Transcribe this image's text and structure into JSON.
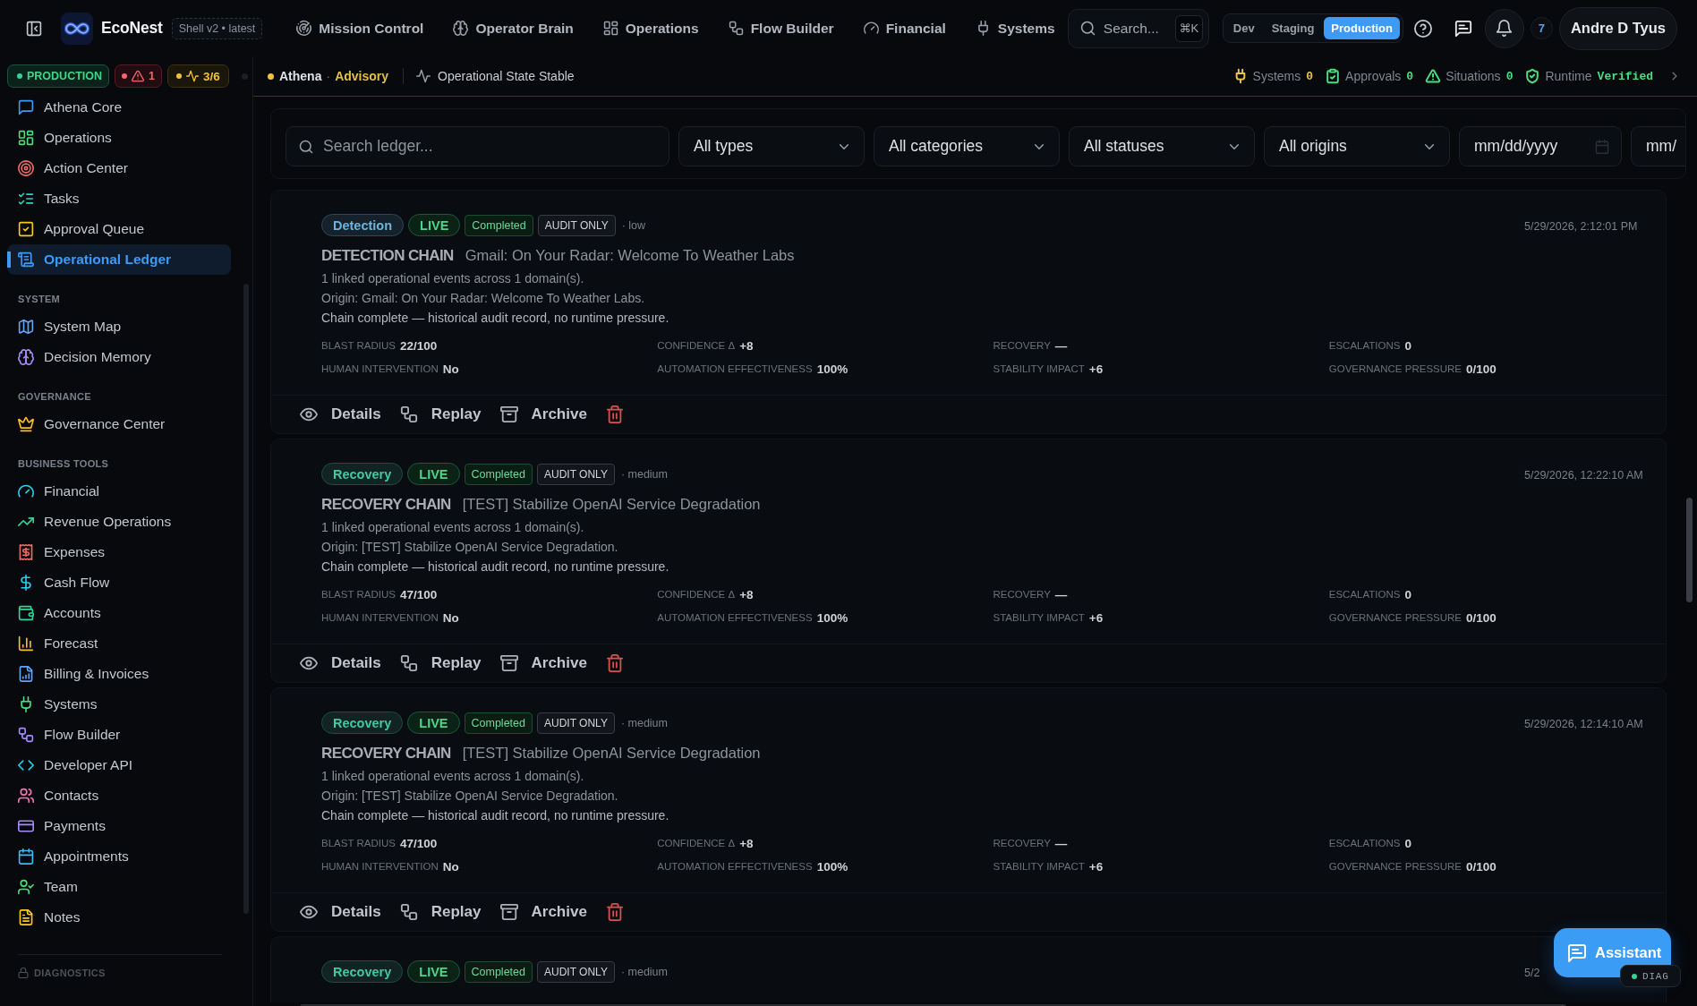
{
  "header": {
    "brand": "EcoNest",
    "build_badge": "Shell v2 • latest",
    "nav": [
      "Mission Control",
      "Operator Brain",
      "Operations",
      "Flow Builder",
      "Financial",
      "Systems"
    ],
    "search": {
      "placeholder": "Search...",
      "shortcut": "⌘K"
    },
    "environments": [
      {
        "label": "Dev",
        "selected": false
      },
      {
        "label": "Staging",
        "selected": false
      },
      {
        "label": "Production",
        "selected": true
      }
    ],
    "notification_count": "7",
    "user": "Andre D Tyus"
  },
  "status_strip": {
    "environment": "PRODUCTION",
    "alerts": "1",
    "health": "3/6",
    "assistant": {
      "name": "Athena",
      "separator": "·",
      "mode": "Advisory"
    },
    "state": "Operational State Stable",
    "indicators": [
      {
        "label": "Systems",
        "value": "0",
        "color": "#e8c547"
      },
      {
        "label": "Approvals",
        "value": "0",
        "color": "#4ade80"
      },
      {
        "label": "Situations",
        "value": "0",
        "color": "#4ade80"
      },
      {
        "label": "Runtime",
        "value": "Verified",
        "color": "#4ade80"
      }
    ]
  },
  "sidebar": {
    "sections": [
      {
        "items": [
          {
            "label": "Athena Core",
            "color": "#3d9bf7",
            "selected": false
          },
          {
            "label": "Operations",
            "color": "#4ade80",
            "selected": false
          },
          {
            "label": "Action Center",
            "color": "#f06a6a",
            "selected": false
          },
          {
            "label": "Tasks",
            "color": "#2dd4bf",
            "selected": false
          },
          {
            "label": "Approval Queue",
            "color": "#facc15",
            "selected": false
          },
          {
            "label": "Operational Ledger",
            "color": "#3d9bf7",
            "selected": true
          }
        ]
      },
      {
        "title": "SYSTEM",
        "items": [
          {
            "label": "System Map",
            "color": "#60a5fa",
            "selected": false
          },
          {
            "label": "Decision Memory",
            "color": "#a78bfa",
            "selected": false
          }
        ]
      },
      {
        "title": "GOVERNANCE",
        "items": [
          {
            "label": "Governance Center",
            "color": "#fbbf24",
            "selected": false
          }
        ]
      },
      {
        "title": "BUSINESS TOOLS",
        "items": [
          {
            "label": "Financial",
            "color": "#22d3ee",
            "selected": false
          },
          {
            "label": "Revenue Operations",
            "color": "#34d399",
            "selected": false
          },
          {
            "label": "Expenses",
            "color": "#f06a6a",
            "selected": false
          },
          {
            "label": "Cash Flow",
            "color": "#22d3ee",
            "selected": false
          },
          {
            "label": "Accounts",
            "color": "#34d399",
            "selected": false
          },
          {
            "label": "Forecast",
            "color": "#fbbf24",
            "selected": false
          },
          {
            "label": "Billing & Invoices",
            "color": "#60a5fa",
            "selected": false
          },
          {
            "label": "Systems",
            "color": "#4ade80",
            "selected": false
          },
          {
            "label": "Flow Builder",
            "color": "#a78bfa",
            "selected": false
          },
          {
            "label": "Developer API",
            "color": "#22d3ee",
            "selected": false
          },
          {
            "label": "Contacts",
            "color": "#f472b6",
            "selected": false
          },
          {
            "label": "Payments",
            "color": "#a78bfa",
            "selected": false
          },
          {
            "label": "Appointments",
            "color": "#38bdf8",
            "selected": false
          },
          {
            "label": "Team",
            "color": "#4ade80",
            "selected": false
          },
          {
            "label": "Notes",
            "color": "#facc15",
            "selected": false
          }
        ]
      }
    ],
    "locked_section": "DIAGNOSTICS"
  },
  "filters": {
    "search": {
      "placeholder": "Search ledger..."
    },
    "selects": [
      "All types",
      "All categories",
      "All statuses",
      "All origins"
    ],
    "dates": [
      {
        "placeholder": "mm/dd/yyyy"
      },
      {
        "placeholder": "mm/"
      }
    ]
  },
  "entries": [
    {
      "tags": [
        {
          "kind": "category",
          "label": "Detection",
          "color": "#6cb4dc"
        },
        {
          "kind": "live",
          "label": "LIVE"
        },
        {
          "kind": "status",
          "label": "Completed"
        },
        {
          "kind": "audit",
          "label": "AUDIT ONLY"
        }
      ],
      "severity": "· low",
      "timestamp": "5/29/2026, 2:12:01 PM",
      "chain": "DETECTION CHAIN",
      "title": "Gmail: On Your Radar: Welcome To Weather Labs",
      "lines": [
        "1 linked operational events across 1 domain(s).",
        "Origin: Gmail: On Your Radar: Welcome To Weather Labs."
      ],
      "note": "Chain complete — historical audit record, no runtime pressure.",
      "metrics": [
        {
          "label": "BLAST RADIUS",
          "value": "22/100"
        },
        {
          "label": "CONFIDENCE Δ",
          "value": "+8"
        },
        {
          "label": "RECOVERY",
          "value": "—"
        },
        {
          "label": "ESCALATIONS",
          "value": "0"
        },
        {
          "label": "HUMAN INTERVENTION",
          "value": "No"
        },
        {
          "label": "AUTOMATION EFFECTIVENESS",
          "value": "100%"
        },
        {
          "label": "STABILITY IMPACT",
          "value": "+6"
        },
        {
          "label": "GOVERNANCE PRESSURE",
          "value": "0/100"
        }
      ],
      "actions": [
        {
          "kind": "details",
          "label": "Details"
        },
        {
          "kind": "replay",
          "label": "Replay"
        },
        {
          "kind": "archive",
          "label": "Archive"
        },
        {
          "kind": "delete"
        }
      ]
    },
    {
      "tags": [
        {
          "kind": "category",
          "label": "Recovery",
          "color": "#45c7a0"
        },
        {
          "kind": "live",
          "label": "LIVE"
        },
        {
          "kind": "status",
          "label": "Completed"
        },
        {
          "kind": "audit",
          "label": "AUDIT ONLY"
        }
      ],
      "severity": "· medium",
      "timestamp": "5/29/2026, 12:22:10 AM",
      "chain": "RECOVERY CHAIN",
      "title": "[TEST] Stabilize OpenAI Service Degradation",
      "lines": [
        "1 linked operational events across 1 domain(s).",
        "Origin: [TEST] Stabilize OpenAI Service Degradation."
      ],
      "note": "Chain complete — historical audit record, no runtime pressure.",
      "metrics": [
        {
          "label": "BLAST RADIUS",
          "value": "47/100"
        },
        {
          "label": "CONFIDENCE Δ",
          "value": "+8"
        },
        {
          "label": "RECOVERY",
          "value": "—"
        },
        {
          "label": "ESCALATIONS",
          "value": "0"
        },
        {
          "label": "HUMAN INTERVENTION",
          "value": "No"
        },
        {
          "label": "AUTOMATION EFFECTIVENESS",
          "value": "100%"
        },
        {
          "label": "STABILITY IMPACT",
          "value": "+6"
        },
        {
          "label": "GOVERNANCE PRESSURE",
          "value": "0/100"
        }
      ],
      "actions": [
        {
          "kind": "details",
          "label": "Details"
        },
        {
          "kind": "replay",
          "label": "Replay"
        },
        {
          "kind": "archive",
          "label": "Archive"
        },
        {
          "kind": "delete"
        }
      ]
    },
    {
      "tags": [
        {
          "kind": "category",
          "label": "Recovery",
          "color": "#45c7a0"
        },
        {
          "kind": "live",
          "label": "LIVE"
        },
        {
          "kind": "status",
          "label": "Completed"
        },
        {
          "kind": "audit",
          "label": "AUDIT ONLY"
        }
      ],
      "severity": "· medium",
      "timestamp": "5/29/2026, 12:14:10 AM",
      "chain": "RECOVERY CHAIN",
      "title": "[TEST] Stabilize OpenAI Service Degradation",
      "lines": [
        "1 linked operational events across 1 domain(s).",
        "Origin: [TEST] Stabilize OpenAI Service Degradation."
      ],
      "note": "Chain complete — historical audit record, no runtime pressure.",
      "metrics": [
        {
          "label": "BLAST RADIUS",
          "value": "47/100"
        },
        {
          "label": "CONFIDENCE Δ",
          "value": "+8"
        },
        {
          "label": "RECOVERY",
          "value": "—"
        },
        {
          "label": "ESCALATIONS",
          "value": "0"
        },
        {
          "label": "HUMAN INTERVENTION",
          "value": "No"
        },
        {
          "label": "AUTOMATION EFFECTIVENESS",
          "value": "100%"
        },
        {
          "label": "STABILITY IMPACT",
          "value": "+6"
        },
        {
          "label": "GOVERNANCE PRESSURE",
          "value": "0/100"
        }
      ],
      "actions": [
        {
          "kind": "details",
          "label": "Details"
        },
        {
          "kind": "replay",
          "label": "Replay"
        },
        {
          "kind": "archive",
          "label": "Archive"
        },
        {
          "kind": "delete"
        }
      ]
    },
    {
      "tags": [
        {
          "kind": "category",
          "label": "Recovery",
          "color": "#45c7a0"
        },
        {
          "kind": "live",
          "label": "LIVE"
        },
        {
          "kind": "status",
          "label": "Completed"
        },
        {
          "kind": "audit",
          "label": "AUDIT ONLY"
        }
      ],
      "severity": "· medium",
      "timestamp": "5/2"
    }
  ],
  "assistant_button": "Assistant",
  "diag_badge": "DIAG"
}
